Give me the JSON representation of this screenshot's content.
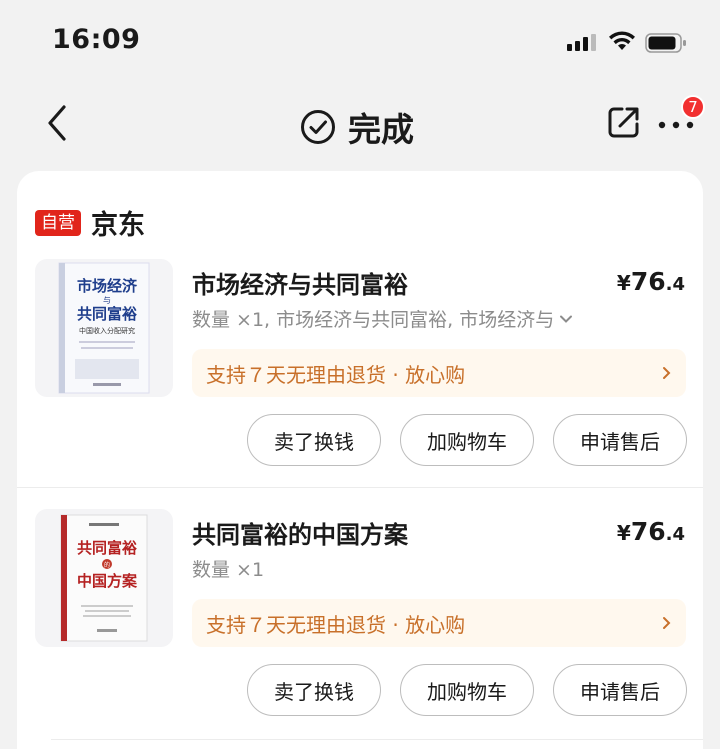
{
  "status_bar": {
    "time": "16:09"
  },
  "nav": {
    "title": "完成",
    "notification_count": "7",
    "icons": {
      "back": "chevron-left-icon",
      "status": "check-circle-icon",
      "share": "share-icon",
      "more": "more-dots-icon"
    }
  },
  "shop": {
    "tag": "自营",
    "name": "京东"
  },
  "items": [
    {
      "title": "市场经济与共同富裕",
      "price_symbol": "¥",
      "price_int": "76",
      "price_dec": ".4",
      "meta": "数量 ×1, 市场经济与共同富裕, 市场经济与",
      "promo": "支持７天无理由退货 · 放心购",
      "cover": {
        "title_line1": "市场经济",
        "title_mid": "与",
        "title_line2": "共同富裕",
        "subtitle": "中国收入分配研究"
      },
      "buttons": [
        "卖了换钱",
        "加购物车",
        "申请售后"
      ]
    },
    {
      "title": "共同富裕的中国方案",
      "price_symbol": "¥",
      "price_int": "76",
      "price_dec": ".4",
      "meta": "数量 ×1",
      "promo": "支持７天无理由退货 · 放心购",
      "cover": {
        "title_line1": "共同富裕",
        "title_mid": "的",
        "title_line2": "中国方案"
      },
      "buttons": [
        "卖了换钱",
        "加购物车",
        "申请售后"
      ]
    }
  ],
  "colors": {
    "brand_red": "#e1251b",
    "badge_red": "#f23030",
    "promo_text": "#c8702a",
    "promo_bg": "#fff8ee"
  }
}
